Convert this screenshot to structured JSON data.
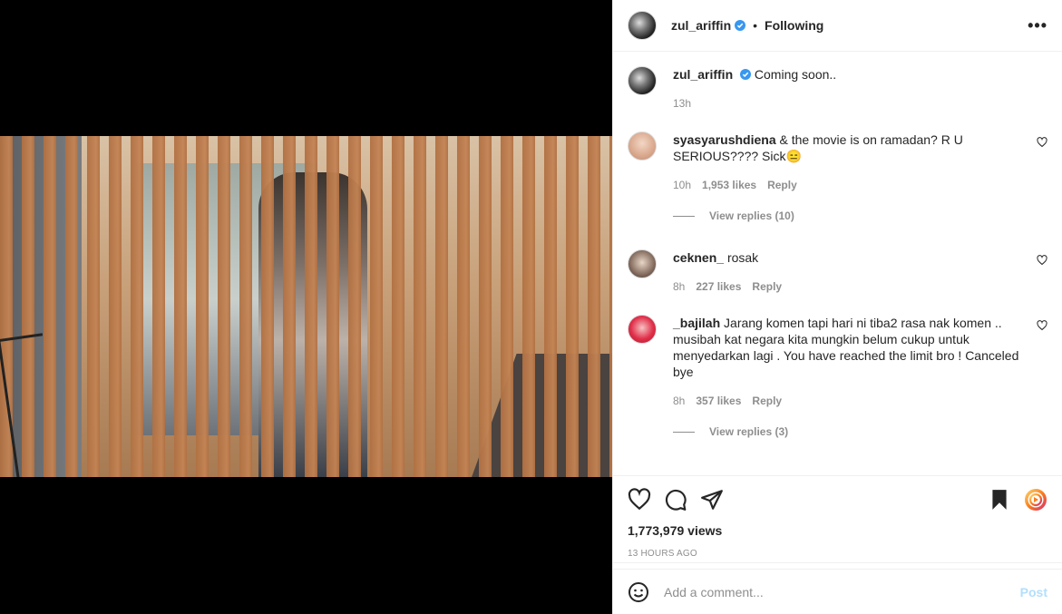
{
  "header": {
    "username": "zul_ariffin",
    "dot": "•",
    "following": "Following",
    "more": "•••"
  },
  "caption": {
    "username": "zul_ariffin",
    "text": "Coming soon..",
    "time": "13h"
  },
  "comments": [
    {
      "username": "syasyarushdiena",
      "text": "& the movie is on ramadan? R U SERIOUS???? Sick😑",
      "time": "10h",
      "likes": "1,953 likes",
      "reply": "Reply",
      "view_replies": "View replies (10)"
    },
    {
      "username": "ceknen_",
      "text": "rosak",
      "time": "8h",
      "likes": "227 likes",
      "reply": "Reply"
    },
    {
      "username": "_bajilah",
      "text": "Jarang komen tapi hari ni tiba2 rasa nak komen .. musibah kat negara kita mungkin belum cukup untuk menyedarkan lagi . You have reached the limit bro ! Canceled bye",
      "time": "8h",
      "likes": "357 likes",
      "reply": "Reply",
      "view_replies": "View replies (3)"
    }
  ],
  "stats": {
    "views": "1,773,979 views",
    "posted": "13 HOURS AGO"
  },
  "add_comment": {
    "placeholder": "Add a comment...",
    "post": "Post"
  },
  "colors": {
    "verified": "#3897f0",
    "post_disabled": "#b2dffc"
  }
}
